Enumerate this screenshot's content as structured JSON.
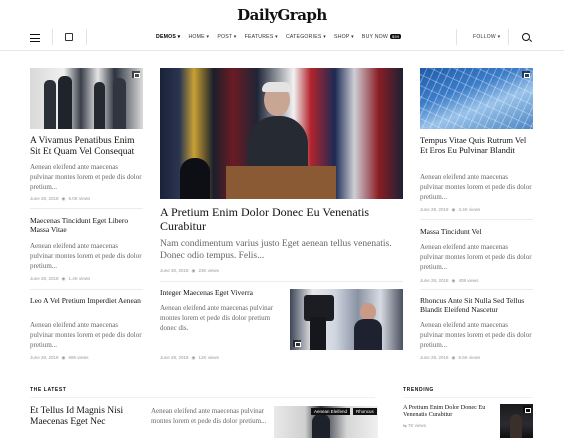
{
  "header": {
    "logo": "DailyGraph",
    "nav": [
      {
        "label": "DEMOS",
        "active": true
      },
      {
        "label": "HOME"
      },
      {
        "label": "POST"
      },
      {
        "label": "FEATURES"
      },
      {
        "label": "CATEGORIES"
      },
      {
        "label": "SHOP"
      },
      {
        "label": "BUY NOW",
        "badge": "$59"
      }
    ],
    "follow": "FOLLOW"
  },
  "left": [
    {
      "title": "A Vivamus Penatibus Enim Sit Et Quam Vel Consequat",
      "excerpt": "Aenean eleifend ante maecenas pulvinar montes lorem et pede dis dolor pretium...",
      "date": "June 28, 2018",
      "views": "5.0K views"
    },
    {
      "title": "Maecenas Tincidunt Eget Libero Massa Vitae",
      "excerpt": "Aenean eleifend ante maecenas pulvinar montes lorem et pede dis dolor pretium...",
      "date": "June 28, 2018",
      "views": "1.4K views"
    },
    {
      "title": "Leo A Vel Pretium Imperdiet Aenean",
      "excerpt": "Aenean eleifend ante maecenas pulvinar montes lorem et pede dis dolor pretium...",
      "date": "June 28, 2018",
      "views": "696 views"
    }
  ],
  "center": {
    "title": "A Pretium Enim Dolor Donec Eu Venenatis Curabitur",
    "excerpt": "Nam condimentum varius justo Eget aenean tellus venenatis. Donec odio tempus. Felis...",
    "date": "June 30, 2018",
    "views": "23K views",
    "sub": {
      "title": "Integer Maecenas Eget Viverra",
      "excerpt": "Aenean eleifend ante maecenas pulvinar montes lorem et pede dis dolor pretium donec dis.",
      "date": "June 28, 2018",
      "views": "12K views"
    }
  },
  "right": [
    {
      "title": "Tempus Vitae Quis Rutrum Vel Et Eros Eu Pulvinar Blandit",
      "excerpt": "Aenean eleifend ante maecenas pulvinar montes lorem et pede dis dolor pretium...",
      "date": "June 28, 2018",
      "views": "3.4K views"
    },
    {
      "title": "Massa Tincidunt Vel",
      "excerpt": "Aenean eleifend ante maecenas pulvinar montes lorem et pede dis dolor pretium...",
      "date": "June 28, 2018",
      "views": "408 views"
    },
    {
      "title": "Rhoncus Ante Sit Nulla Sed Tellus Blandit Eleifend Nascetur",
      "excerpt": "Aenean eleifend ante maecenas pulvinar montes lorem et pede dis dolor pretium...",
      "date": "June 28, 2018",
      "views": "5.6K views"
    }
  ],
  "latest": {
    "heading": "THE LATEST",
    "title": "Et Tellus Id Magnis Nisi Maecenas Eget Nec",
    "excerpt": "Aenean eleifend ante maecenas pulvinar montes lorem et pede dis dolor pretium...",
    "tags": [
      "Aenean Eleifend",
      "Rhoncus"
    ]
  },
  "trending": {
    "heading": "TRENDING",
    "title": "A Pretium Enim Dolor Donec Eu Venenatis Curabitur",
    "views": "7K views"
  }
}
